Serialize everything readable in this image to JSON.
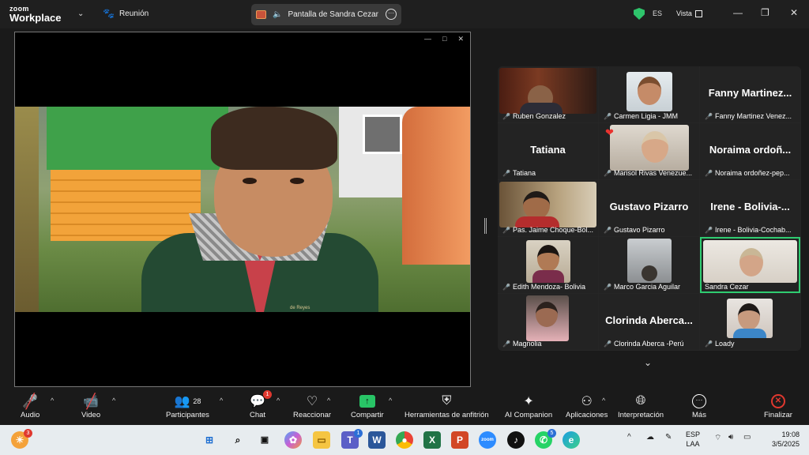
{
  "app": {
    "brand_top": "zoom",
    "brand_bottom": "Workplace",
    "meeting_label": "Reunión"
  },
  "share_title": "Pantalla de Sandra Cezar",
  "top_right": {
    "language": "ES",
    "view_label": "Vista"
  },
  "video_caption": "de Reyes",
  "participants": [
    {
      "name": "Ruben Gonzalez",
      "mode": "video"
    },
    {
      "name": "Carmen Ligia - JMM",
      "mode": "video"
    },
    {
      "name": "Fanny Martinez Venez...",
      "display": "Fanny Martinez...",
      "mode": "name"
    },
    {
      "name": "Tatiana",
      "display": "Tatiana",
      "mode": "name"
    },
    {
      "name": "Marisol Rivas Venezue...",
      "mode": "video"
    },
    {
      "name": "Noraima ordoñez-pep...",
      "display": "Noraima ordoñ...",
      "mode": "name"
    },
    {
      "name": "Pas. Jaime Choque-Bol...",
      "mode": "video"
    },
    {
      "name": "Gustavo Pizarro",
      "display": "Gustavo Pizarro",
      "mode": "name"
    },
    {
      "name": "Irene - Bolivia-Cochab...",
      "display": "Irene - Bolivia-...",
      "mode": "name"
    },
    {
      "name": "Edith Mendoza- Bolivia",
      "mode": "video"
    },
    {
      "name": "Marco Garcia Aguilar",
      "mode": "video"
    },
    {
      "name": "Sandra Cezar",
      "mode": "video",
      "active": true
    },
    {
      "name": "Magnolia",
      "mode": "video"
    },
    {
      "name": "Clorinda Aberca -Perú",
      "display": "Clorinda Aberca...",
      "mode": "name"
    },
    {
      "name": "Loady",
      "mode": "video"
    }
  ],
  "toolbar": {
    "audio": "Audio",
    "video": "Video",
    "participants": "Participantes",
    "participants_count": "28",
    "chat": "Chat",
    "chat_badge": "1",
    "react": "Reaccionar",
    "share": "Compartir",
    "host_tools": "Herramientas de anfitrión",
    "companion": "AI Companion",
    "apps": "Aplicaciones",
    "interpretation": "Interpretación",
    "more": "Más",
    "end": "Finalizar"
  },
  "taskbar": {
    "widget_badge": "3",
    "teams_badge": "1",
    "whatsapp_badge": "5",
    "zoom_label": "zoom",
    "lang_top": "ESP",
    "lang_bottom": "LAA",
    "time": "19:08",
    "date": "3/5/2025"
  },
  "colors": {
    "active_border": "#2fcc71",
    "share_green": "#28c466",
    "mute_red": "#e34a4a",
    "end_red": "#e0382f"
  }
}
